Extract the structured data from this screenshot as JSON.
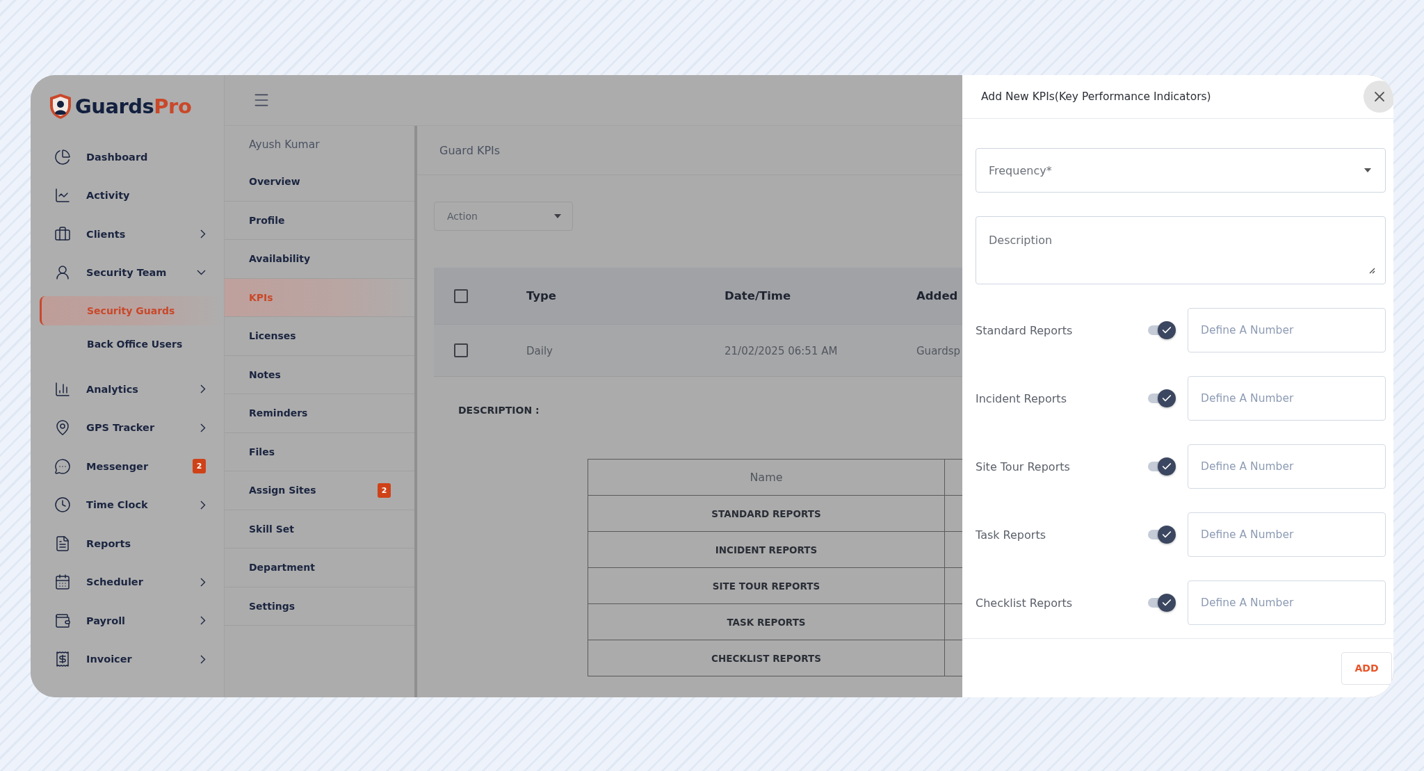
{
  "logo": {
    "main": "Guards",
    "accent": "Pro"
  },
  "sidebar": {
    "items": [
      {
        "label": "Dashboard",
        "selected": false
      },
      {
        "label": "Activity",
        "selected": false
      },
      {
        "label": "Clients",
        "selected": false,
        "expanded": false
      },
      {
        "label": "Security Team",
        "selected": false,
        "expanded": true,
        "children": [
          {
            "label": "Security Guards",
            "selected": true
          },
          {
            "label": "Back Office Users",
            "selected": false
          }
        ]
      },
      {
        "label": "Analytics",
        "selected": false,
        "expanded": false
      },
      {
        "label": "GPS Tracker",
        "selected": false,
        "expanded": false
      },
      {
        "label": "Messenger",
        "selected": false,
        "badge": "2"
      },
      {
        "label": "Time Clock",
        "selected": false,
        "expanded": false
      },
      {
        "label": "Reports",
        "selected": false
      },
      {
        "label": "Scheduler",
        "selected": false,
        "expanded": false
      },
      {
        "label": "Payroll",
        "selected": false,
        "expanded": false
      },
      {
        "label": "Invoicer",
        "selected": false,
        "expanded": false
      }
    ]
  },
  "profile_menu": {
    "user": "Ayush Kumar",
    "items": [
      {
        "label": "Overview",
        "selected": false
      },
      {
        "label": "Profile",
        "selected": false
      },
      {
        "label": "Availability",
        "selected": false
      },
      {
        "label": "KPIs",
        "selected": true
      },
      {
        "label": "Licenses",
        "selected": false
      },
      {
        "label": "Notes",
        "selected": false
      },
      {
        "label": "Reminders",
        "selected": false
      },
      {
        "label": "Files",
        "selected": false
      },
      {
        "label": "Assign Sites",
        "selected": false,
        "badge": "2"
      },
      {
        "label": "Skill Set",
        "selected": false
      },
      {
        "label": "Department",
        "selected": false
      },
      {
        "label": "Settings",
        "selected": false
      }
    ]
  },
  "content": {
    "title": "Guard KPIs",
    "action_select": {
      "placeholder": "Action"
    },
    "table": {
      "header_checked": false,
      "columns": [
        "Type",
        "Date/Time",
        "Added"
      ],
      "rows": [
        {
          "checked": false,
          "cells": [
            "Daily",
            "21/02/2025 06:51 AM",
            "Guardsp"
          ]
        }
      ]
    },
    "description_label": "DESCRIPTION :",
    "kpi_table": {
      "columns": [
        "Name"
      ],
      "rows": [
        "STANDARD REPORTS",
        "INCIDENT REPORTS",
        "SITE TOUR REPORTS",
        "TASK REPORTS",
        "CHECKLIST REPORTS"
      ]
    }
  },
  "drawer": {
    "title": "Add New KPIs(Key Performance Indicators)",
    "frequency": {
      "placeholder": "Frequency*"
    },
    "description": {
      "placeholder": "Description"
    },
    "reports": [
      {
        "label": "Standard Reports",
        "on": true,
        "placeholder": "Define A Number"
      },
      {
        "label": "Incident Reports",
        "on": true,
        "placeholder": "Define A Number"
      },
      {
        "label": "Site Tour Reports",
        "on": true,
        "placeholder": "Define A Number"
      },
      {
        "label": "Task Reports",
        "on": true,
        "placeholder": "Define A Number"
      },
      {
        "label": "Checklist Reports",
        "on": true,
        "placeholder": "Define A Number"
      }
    ],
    "add_button": "ADD"
  }
}
